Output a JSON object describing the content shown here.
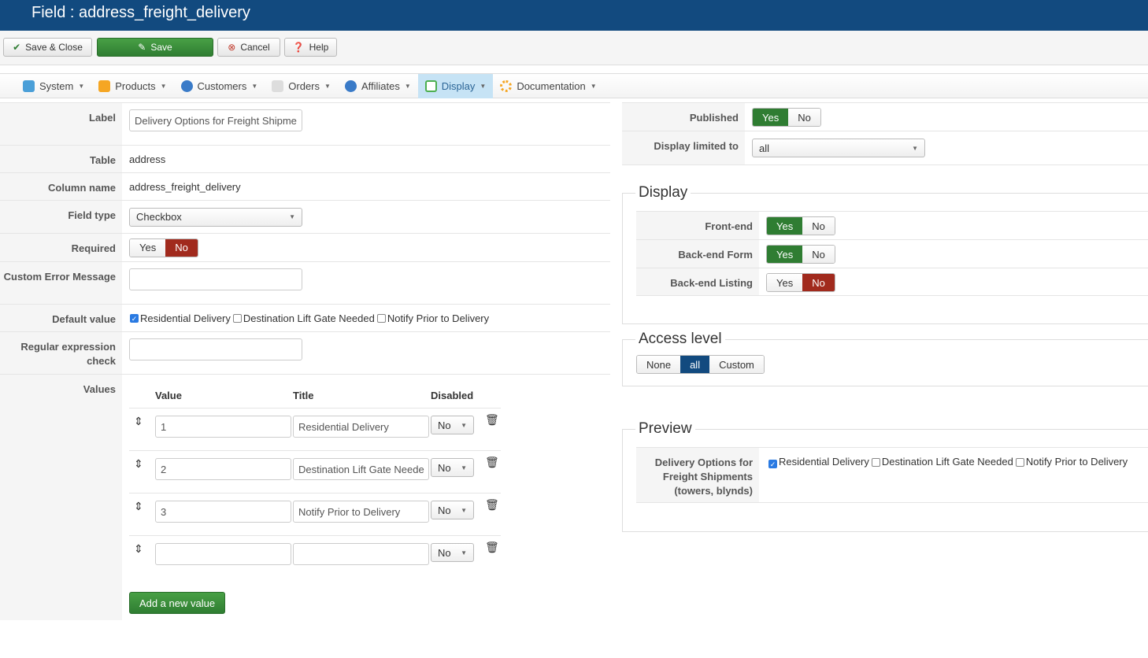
{
  "header": {
    "title": "Field : address_freight_delivery"
  },
  "toolbar": {
    "save_close": "Save & Close",
    "save": "Save",
    "cancel": "Cancel",
    "help": "Help"
  },
  "nav": [
    {
      "label": "System"
    },
    {
      "label": "Products"
    },
    {
      "label": "Customers"
    },
    {
      "label": "Orders"
    },
    {
      "label": "Affiliates"
    },
    {
      "label": "Display"
    },
    {
      "label": "Documentation"
    }
  ],
  "form": {
    "label": {
      "label": "Label",
      "value": "Delivery Options for Freight Shipme"
    },
    "table": {
      "label": "Table",
      "value": "address"
    },
    "column": {
      "label": "Column name",
      "value": "address_freight_delivery"
    },
    "field_type": {
      "label": "Field type",
      "value": "Checkbox"
    },
    "required": {
      "label": "Required",
      "yes": "Yes",
      "no": "No"
    },
    "custom_error": {
      "label": "Custom Error Message",
      "value": ""
    },
    "default_value": {
      "label": "Default value",
      "options": [
        "Residential Delivery",
        "Destination Lift Gate Needed",
        "Notify Prior to Delivery"
      ]
    },
    "regex": {
      "label": "Regular expression check",
      "value": ""
    },
    "values": {
      "label": "Values",
      "headers": [
        "Value",
        "Title",
        "Disabled"
      ],
      "rows": [
        {
          "value": "1",
          "title": "Residential Delivery",
          "disabled": "No"
        },
        {
          "value": "2",
          "title": "Destination Lift Gate Neede",
          "disabled": "No"
        },
        {
          "value": "3",
          "title": "Notify Prior to Delivery",
          "disabled": "No"
        },
        {
          "value": "",
          "title": "",
          "disabled": "No"
        }
      ],
      "add": "Add a new value"
    }
  },
  "right": {
    "published": {
      "label": "Published",
      "yes": "Yes",
      "no": "No"
    },
    "limited": {
      "label": "Display limited to",
      "value": "all"
    },
    "display": {
      "legend": "Display",
      "frontend": "Front-end",
      "backend_form": "Back-end Form",
      "backend_listing": "Back-end Listing",
      "yes": "Yes",
      "no": "No"
    },
    "access": {
      "legend": "Access level",
      "none": "None",
      "all": "all",
      "custom": "Custom"
    },
    "preview": {
      "legend": "Preview",
      "label": "Delivery Options for Freight Shipments (towers, blynds)",
      "options": [
        "Residential Delivery",
        "Destination Lift Gate Needed",
        "Notify Prior to Delivery"
      ]
    }
  }
}
